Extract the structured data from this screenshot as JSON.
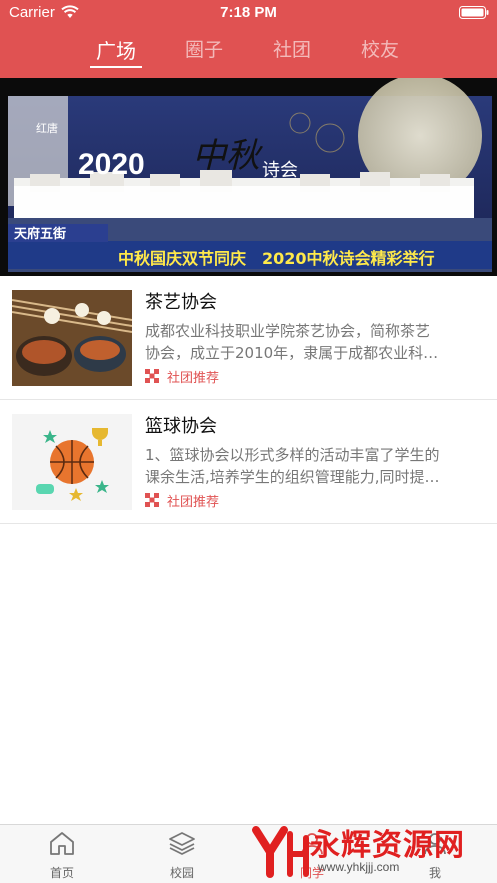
{
  "status_bar": {
    "carrier": "Carrier",
    "time": "7:18 PM"
  },
  "top_tabs": [
    {
      "label": "广场",
      "active": true
    },
    {
      "label": "圈子",
      "active": false
    },
    {
      "label": "社团",
      "active": false
    },
    {
      "label": "校友",
      "active": false
    }
  ],
  "banner": {
    "year_text": "2020",
    "big_char": "中秋",
    "poem_text": "诗会",
    "station_text": "天府五街",
    "caption": "中秋国庆双节同庆　2020中秋诗会精彩举行",
    "corner_text": "红唐"
  },
  "items": [
    {
      "title": "茶艺协会",
      "desc_line1": "成都农业科技职业学院茶艺协会，简称茶艺",
      "desc_line2": "协会，成立于2010年，隶属于成都农业科…",
      "tag": "社团推荐"
    },
    {
      "title": "篮球协会",
      "desc_line1": "1、篮球协会以形式多样的活动丰富了学生的",
      "desc_line2": "课余生活,培养学生的组织管理能力,同时提…",
      "tag": "社团推荐"
    }
  ],
  "tabbar": [
    {
      "label": "首页",
      "icon": "home-icon"
    },
    {
      "label": "校园",
      "icon": "layers-icon"
    },
    {
      "label": "同学",
      "icon": "people-icon",
      "active": true
    },
    {
      "label": "我",
      "icon": "profile-icon"
    }
  ],
  "watermark": {
    "brand": "永辉资源网",
    "url": "www.yhkjjj.com"
  },
  "colors": {
    "accent": "#e05252",
    "header": "#e05252"
  }
}
